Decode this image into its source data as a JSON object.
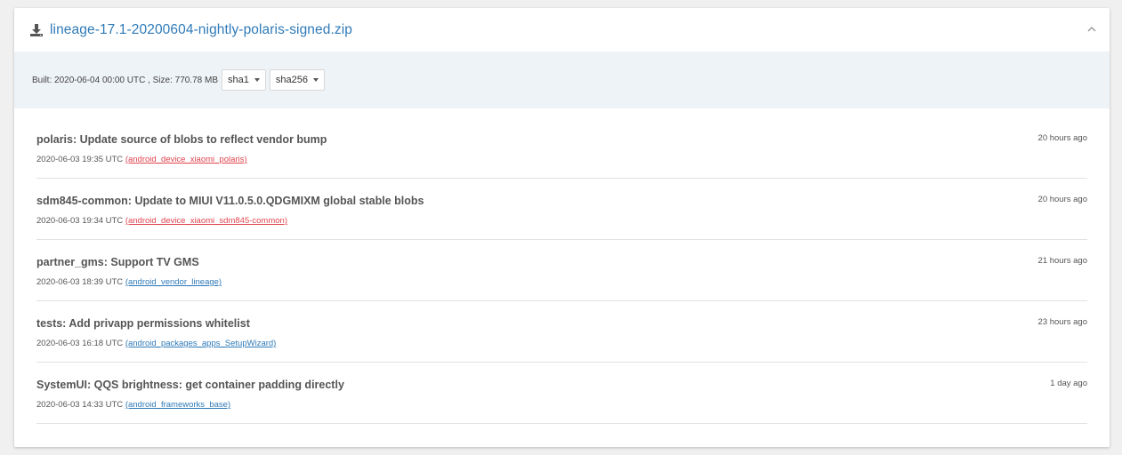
{
  "header": {
    "file_name": "lineage-17.1-20200604-nightly-polaris-signed.zip",
    "download_icon": "download-icon",
    "collapse_icon": "chevron-up-icon"
  },
  "meta": {
    "built_text": "Built: 2020-06-04 00:00 UTC , Size: 770.78 MB",
    "sha1_label": "sha1",
    "sha256_label": "sha256"
  },
  "colors": {
    "link": "#2f7ab8",
    "repo_device": "#e0454f",
    "repo_other": "#2f7ab8",
    "meta_bg": "#eef3f8"
  },
  "changes": [
    {
      "title": "polaris: Update source of blobs to reflect vendor bump",
      "timestamp": "2020-06-03 19:35 UTC",
      "repo": "(android_device_xiaomi_polaris)",
      "age": "20 hours ago"
    },
    {
      "title": "sdm845-common: Update to MIUI V11.0.5.0.QDGMIXM global stable blobs",
      "timestamp": "2020-06-03 19:34 UTC",
      "repo": "(android_device_xiaomi_sdm845-common)",
      "age": "20 hours ago"
    },
    {
      "title": "partner_gms: Support TV GMS",
      "timestamp": "2020-06-03 18:39 UTC",
      "repo": "(android_vendor_lineage)",
      "age": "21 hours ago"
    },
    {
      "title": "tests: Add privapp permissions whitelist",
      "timestamp": "2020-06-03 16:18 UTC",
      "repo": "(android_packages_apps_SetupWizard)",
      "age": "23 hours ago"
    },
    {
      "title": "SystemUI: QQS brightness: get container padding directly",
      "timestamp": "2020-06-03 14:33 UTC",
      "repo": "(android_frameworks_base)",
      "age": "1 day ago"
    }
  ]
}
